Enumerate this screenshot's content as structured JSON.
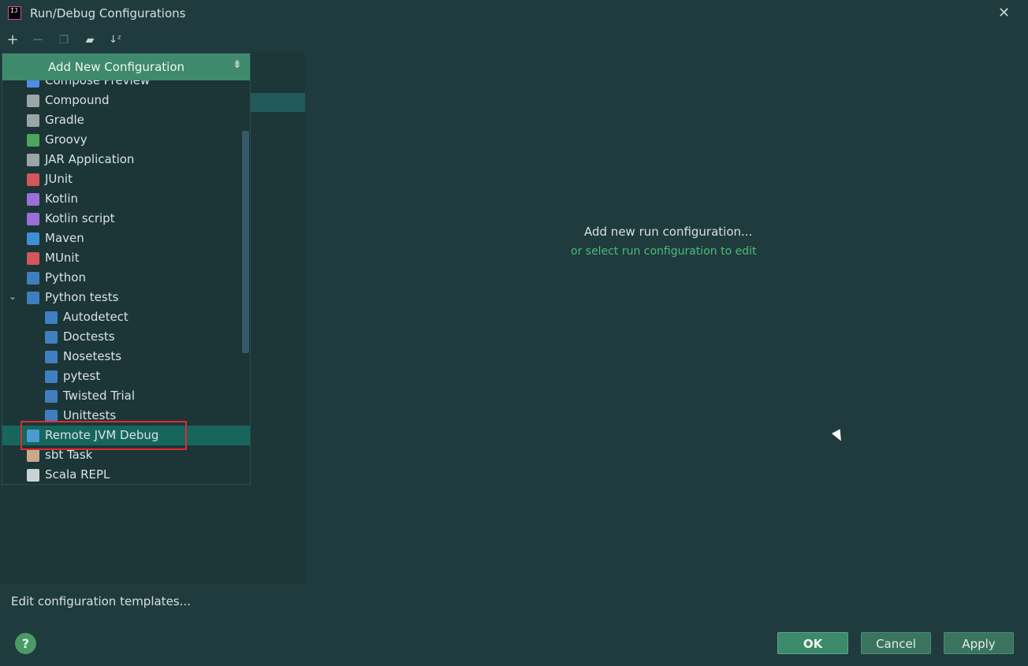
{
  "window": {
    "title": "Run/Debug Configurations",
    "close_icon": "close-icon"
  },
  "toolbar": {
    "add_icon": "plus-icon",
    "remove_icon": "minus-icon",
    "copy_icon": "copy-icon",
    "folder_icon": "new-folder-icon",
    "sort_icon": "sort-icon"
  },
  "popup": {
    "header": "Add New Configuration",
    "items": [
      {
        "label": "Compose Preview",
        "icon": "compose-icon",
        "color": "#4e8fe6"
      },
      {
        "label": "Compound",
        "icon": "compound-icon",
        "color": "#9aa6a6"
      },
      {
        "label": "Gradle",
        "icon": "gradle-icon",
        "color": "#9aa6a6"
      },
      {
        "label": "Groovy",
        "icon": "groovy-icon",
        "color": "#4ca65a"
      },
      {
        "label": "JAR Application",
        "icon": "jar-icon",
        "color": "#9aa6a6"
      },
      {
        "label": "JUnit",
        "icon": "junit-icon",
        "color": "#d2565b"
      },
      {
        "label": "Kotlin",
        "icon": "kotlin-icon",
        "color": "#9a6fd8"
      },
      {
        "label": "Kotlin script",
        "icon": "kotlin-script-icon",
        "color": "#9a6fd8"
      },
      {
        "label": "Maven",
        "icon": "maven-icon",
        "color": "#3f8fd6"
      },
      {
        "label": "MUnit",
        "icon": "munit-icon",
        "color": "#d2565b"
      },
      {
        "label": "Python",
        "icon": "python-icon",
        "color": "#3f7fbf"
      },
      {
        "label": "Python tests",
        "icon": "python-tests-icon",
        "color": "#3f7fbf"
      },
      {
        "label": "Autodetect",
        "icon": "python-test-icon",
        "color": "#3f7fbf"
      },
      {
        "label": "Doctests",
        "icon": "python-test-icon",
        "color": "#3f7fbf"
      },
      {
        "label": "Nosetests",
        "icon": "python-test-icon",
        "color": "#3f7fbf"
      },
      {
        "label": "pytest",
        "icon": "python-test-icon",
        "color": "#3f7fbf"
      },
      {
        "label": "Twisted Trial",
        "icon": "python-test-icon",
        "color": "#3f7fbf"
      },
      {
        "label": "Unittests",
        "icon": "python-test-icon",
        "color": "#3f7fbf"
      },
      {
        "label": "Remote JVM Debug",
        "icon": "remote-debug-icon",
        "color": "#4a9bd0"
      },
      {
        "label": "sbt Task",
        "icon": "sbt-icon",
        "color": "#c9a98a"
      },
      {
        "label": "Scala REPL",
        "icon": "scala-repl-icon",
        "color": "#c9d2d2"
      }
    ],
    "selected_index": 18
  },
  "main": {
    "message": "Add new run configuration...",
    "link": "or select run configuration to edit"
  },
  "footer": {
    "edit_templates": "Edit configuration templates...",
    "help": "?",
    "ok": "OK",
    "cancel": "Cancel",
    "apply": "Apply"
  },
  "colors": {
    "background": "#1f3b3d",
    "accent": "#3f8a6d",
    "selection": "#17665e",
    "highlight": "#e02a32",
    "link": "#4fba7a"
  }
}
